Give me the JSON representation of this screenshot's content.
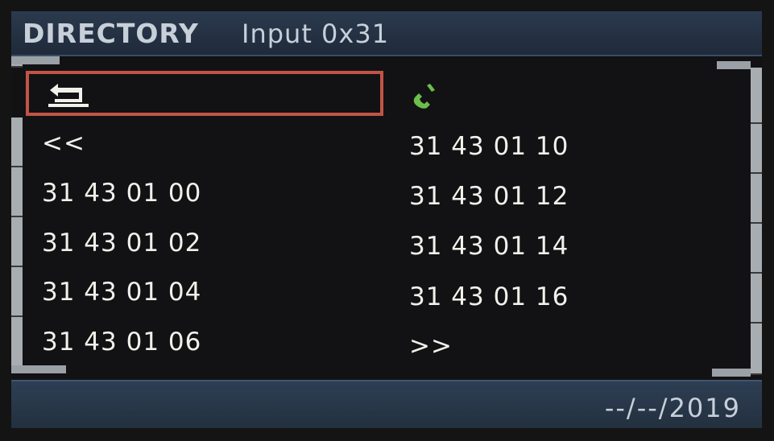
{
  "header": {
    "title": "DIRECTORY",
    "subtitle": "Input 0x31"
  },
  "back_icon": "back-arrow-icon",
  "phone_icon": "phone-icon",
  "colors": {
    "selection_border": "#c25445",
    "phone_green": "#6bbf4a",
    "text": "#f1f0ea",
    "header_text": "#c7cfd9"
  },
  "left_column": {
    "prev_label": "<<",
    "items": [
      "31 43 01 00",
      "31 43 01 02",
      "31 43 01 04",
      "31 43 01 06"
    ]
  },
  "right_column": {
    "items": [
      "31 43 01 10",
      "31 43 01 12",
      "31 43 01 14",
      "31 43 01 16"
    ],
    "next_label": ">>"
  },
  "footer": {
    "date": "--/--/2019"
  }
}
